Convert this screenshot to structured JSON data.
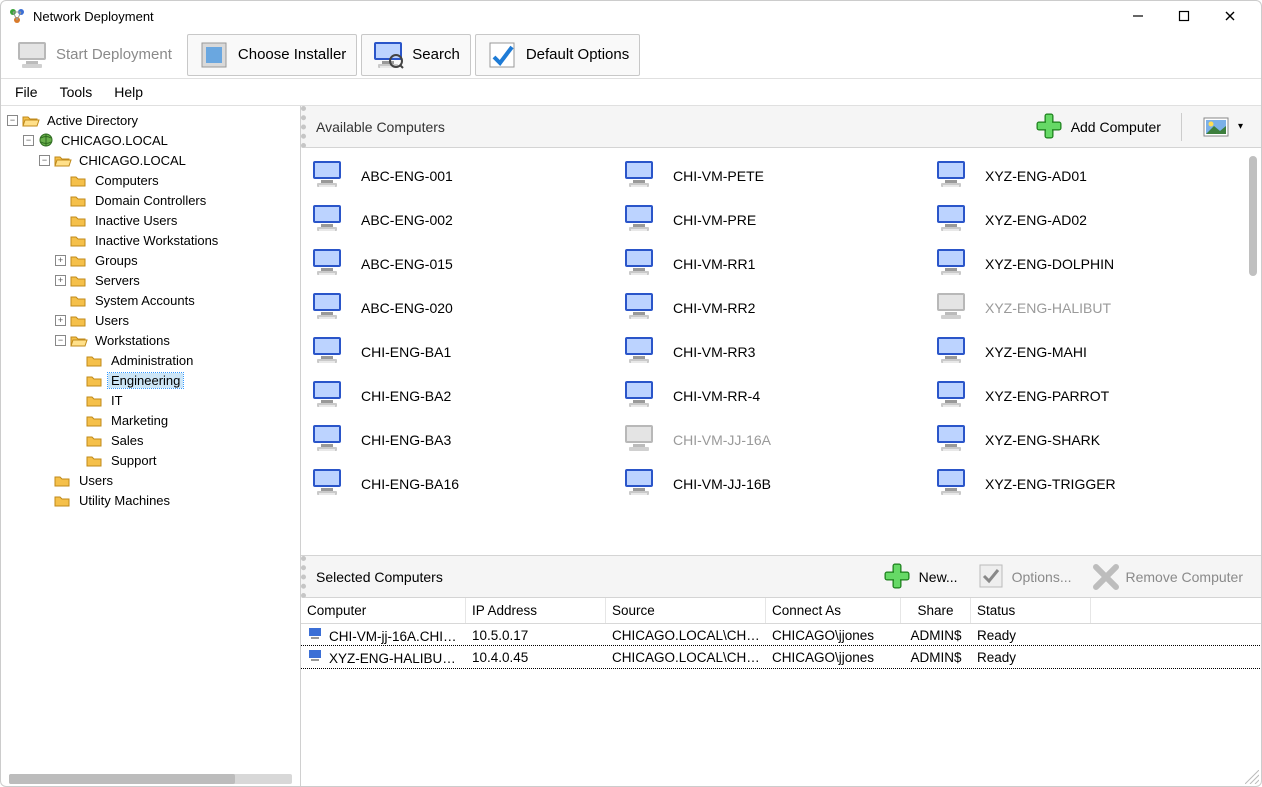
{
  "window": {
    "title": "Network Deployment"
  },
  "ribbon": {
    "start": "Start Deployment",
    "choose": "Choose Installer",
    "search": "Search",
    "defaults": "Default Options"
  },
  "menu": {
    "file": "File",
    "tools": "Tools",
    "help": "Help"
  },
  "tree": {
    "root": "Active Directory",
    "domain": "CHICAGO.LOCAL",
    "sub_domain": "CHICAGO.LOCAL",
    "computers": "Computers",
    "dc": "Domain Controllers",
    "inactive_users": "Inactive Users",
    "inactive_ws": "Inactive Workstations",
    "groups": "Groups",
    "servers": "Servers",
    "sys_accounts": "System Accounts",
    "users": "Users",
    "workstations": "Workstations",
    "ws_admin": "Administration",
    "ws_eng": "Engineering",
    "ws_it": "IT",
    "ws_marketing": "Marketing",
    "ws_sales": "Sales",
    "ws_support": "Support",
    "users2": "Users",
    "utility": "Utility Machines"
  },
  "available": {
    "title": "Available Computers",
    "add_btn": "Add Computer",
    "col1": [
      "ABC-ENG-001",
      "ABC-ENG-002",
      "ABC-ENG-015",
      "ABC-ENG-020",
      "CHI-ENG-BA1",
      "CHI-ENG-BA2",
      "CHI-ENG-BA3",
      "CHI-ENG-BA16"
    ],
    "col2": [
      "CHI-VM-PETE",
      "CHI-VM-PRE",
      "CHI-VM-RR1",
      "CHI-VM-RR2",
      "CHI-VM-RR3",
      "CHI-VM-RR-4",
      "CHI-VM-JJ-16A",
      "CHI-VM-JJ-16B"
    ],
    "col2_grey": [
      false,
      false,
      false,
      false,
      false,
      false,
      true,
      false
    ],
    "col2_blue": [
      false,
      false,
      false,
      false,
      false,
      false,
      false,
      true
    ],
    "col3": [
      "XYZ-ENG-AD01",
      "XYZ-ENG-AD02",
      "XYZ-ENG-DOLPHIN",
      "XYZ-ENG-HALIBUT",
      "XYZ-ENG-MAHI",
      "XYZ-ENG-PARROT",
      "XYZ-ENG-SHARK",
      "XYZ-ENG-TRIGGER"
    ],
    "col3_grey": [
      false,
      false,
      false,
      true,
      false,
      false,
      false,
      false
    ]
  },
  "selected": {
    "title": "Selected Computers",
    "new_btn": "New...",
    "options_btn": "Options...",
    "remove_btn": "Remove Computer",
    "headers": {
      "computer": "Computer",
      "ip": "IP Address",
      "source": "Source",
      "connect": "Connect As",
      "share": "Share",
      "status": "Status"
    },
    "rows": [
      {
        "computer": "CHI-VM-jj-16A.CHIC...",
        "ip": "10.5.0.17",
        "source": "CHICAGO.LOCAL\\CHIC...",
        "connect": "CHICAGO\\jjones",
        "share": "ADMIN$",
        "status": "Ready"
      },
      {
        "computer": "XYZ-ENG-HALIBUT...",
        "ip": "10.4.0.45",
        "source": "CHICAGO.LOCAL\\CHIC...",
        "connect": "CHICAGO\\jjones",
        "share": "ADMIN$",
        "status": "Ready"
      }
    ]
  }
}
